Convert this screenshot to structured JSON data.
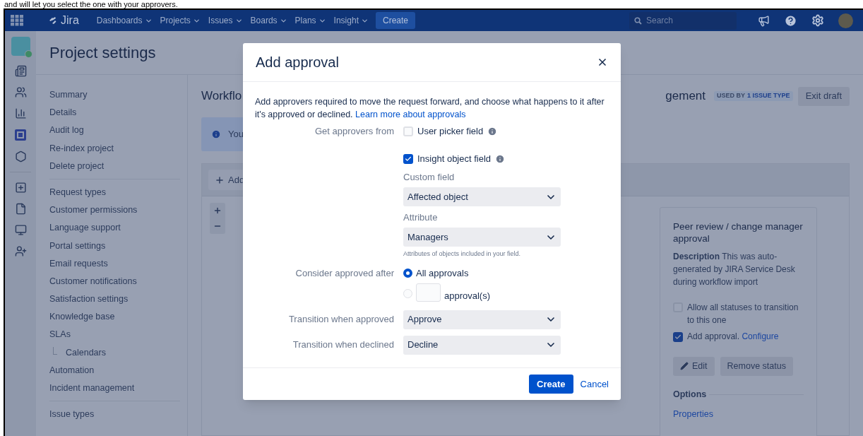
{
  "caption": "and will let you select the one with your approvers.",
  "top_nav": {
    "logo": "Jira",
    "menus": [
      {
        "label": "Dashboards"
      },
      {
        "label": "Projects"
      },
      {
        "label": "Issues"
      },
      {
        "label": "Boards"
      },
      {
        "label": "Plans"
      },
      {
        "label": "Insight"
      }
    ],
    "create": "Create",
    "search": {
      "placeholder": "Search"
    }
  },
  "page_title": "Project settings",
  "sidebar": {
    "groups": [
      {
        "items": [
          {
            "label": "Summary"
          },
          {
            "label": "Details"
          },
          {
            "label": "Audit log"
          },
          {
            "label": "Re-index project"
          },
          {
            "label": "Delete project"
          }
        ]
      },
      {
        "items": [
          {
            "label": "Request types"
          },
          {
            "label": "Customer permissions"
          },
          {
            "label": "Language support"
          },
          {
            "label": "Portal settings"
          },
          {
            "label": "Email requests"
          },
          {
            "label": "Customer notifications"
          },
          {
            "label": "Satisfaction settings"
          },
          {
            "label": "Knowledge base"
          },
          {
            "label": "SLAs",
            "children": [
              {
                "label": "Calendars"
              }
            ]
          },
          {
            "label": "Automation"
          },
          {
            "label": "Incident management"
          }
        ]
      },
      {
        "items": [
          {
            "label": "Issue types"
          }
        ]
      }
    ]
  },
  "workflow": {
    "title_left": "Workflo",
    "title_right": "gement",
    "badge_prefix": "USED BY",
    "badge_count": "1 ISSUE TYPE",
    "exit_button": "Exit draft",
    "banner": "You",
    "add_button": "Add"
  },
  "status_card": {
    "title": "Peer review / change manager approval",
    "description": "**Description** This was auto-generated by JIRA Service Desk during workflow import",
    "checks": [
      {
        "label": "Allow all statuses to transition to this one",
        "checked": false
      },
      {
        "label": "Add approval.",
        "link": "Configure",
        "checked": true
      }
    ],
    "buttons": [
      {
        "label": "Edit",
        "kind": "edit"
      },
      {
        "label": "Remove status",
        "kind": "plain"
      }
    ],
    "options_heading": "Options",
    "options_link": "Properties"
  },
  "modal": {
    "title": "Add approval",
    "intro": "Add approvers required to move the request forward, and choose what happens to it after it's approved or declined.",
    "intro_link": "Learn more about approvals",
    "rows": [
      {
        "kind": "checks",
        "label": "Get approvers from",
        "options": [
          {
            "label": "User picker field",
            "checked": false,
            "info": true
          },
          {
            "label": "Insight object field",
            "checked": true,
            "info": true
          }
        ],
        "fields": [
          {
            "label": "Custom field",
            "value": "Affected object"
          },
          {
            "label": "Attribute",
            "value": "Managers",
            "help": "Attributes of objects included in your field."
          }
        ]
      },
      {
        "kind": "radios",
        "label": "Consider approved after",
        "options": [
          {
            "kind": "text",
            "label": "All approvals",
            "selected": true
          },
          {
            "kind": "count",
            "label": "approval(s)",
            "selected": false
          }
        ]
      },
      {
        "kind": "select",
        "label": "Transition when approved",
        "value": "Approve"
      },
      {
        "kind": "select",
        "label": "Transition when declined",
        "value": "Decline"
      }
    ],
    "create": "Create",
    "cancel": "Cancel"
  }
}
